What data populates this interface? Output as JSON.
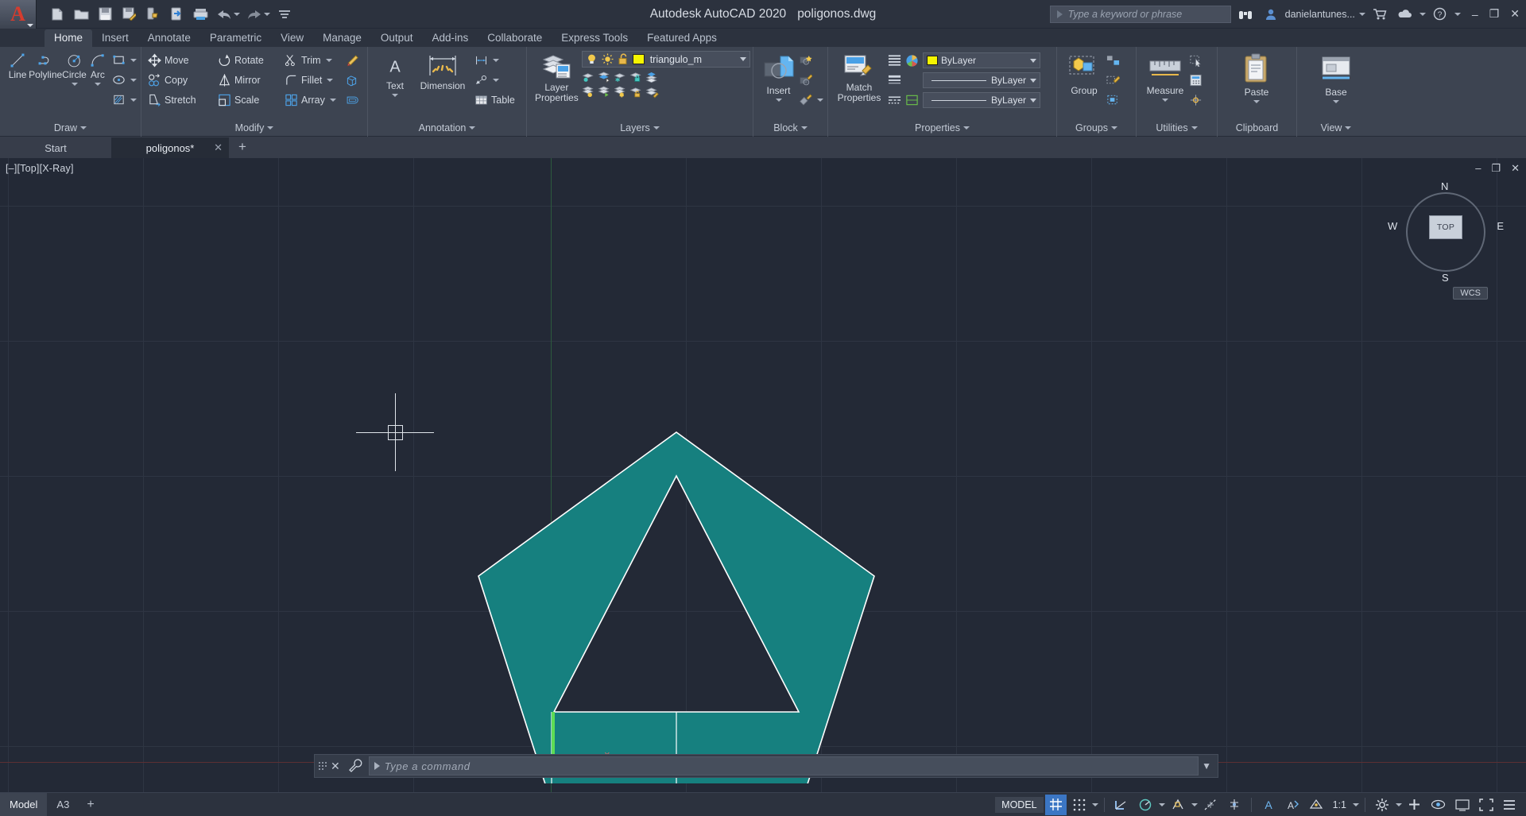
{
  "window": {
    "app_title": "Autodesk AutoCAD 2020",
    "file_name": "poligonos.dwg",
    "minimize": "–",
    "maximize": "❐",
    "close": "✕"
  },
  "quick_access": {
    "items": [
      {
        "name": "new-icon",
        "label": "New"
      },
      {
        "name": "open-icon",
        "label": "Open"
      },
      {
        "name": "save-icon",
        "label": "Save"
      },
      {
        "name": "save-as-icon",
        "label": "Save As"
      },
      {
        "name": "save-to-web-icon",
        "label": "Save to Web & Mobile"
      },
      {
        "name": "open-from-web-icon",
        "label": "Open from Web & Mobile"
      },
      {
        "name": "plot-icon",
        "label": "Plot"
      },
      {
        "name": "undo-icon",
        "label": "Undo"
      },
      {
        "name": "redo-icon",
        "label": "Redo"
      },
      {
        "name": "customize-icon",
        "label": "Customize Quick Access Toolbar"
      }
    ]
  },
  "search": {
    "placeholder": "Type a keyword or phrase"
  },
  "account": {
    "user": "danielantunes...",
    "signin_icon": "person-icon",
    "help_icon": "help-icon",
    "cart_icon": "cart-icon",
    "cloud_icon": "cloud-icon",
    "search_help_icon": "binoculars-icon"
  },
  "ribbon": {
    "tabs": [
      {
        "label": "Home",
        "active": true
      },
      {
        "label": "Insert",
        "active": false
      },
      {
        "label": "Annotate",
        "active": false
      },
      {
        "label": "Parametric",
        "active": false
      },
      {
        "label": "View",
        "active": false
      },
      {
        "label": "Manage",
        "active": false
      },
      {
        "label": "Output",
        "active": false
      },
      {
        "label": "Add-ins",
        "active": false
      },
      {
        "label": "Collaborate",
        "active": false
      },
      {
        "label": "Express Tools",
        "active": false
      },
      {
        "label": "Featured Apps",
        "active": false
      }
    ],
    "panels": {
      "draw": {
        "title": "Draw",
        "big_buttons": [
          {
            "label": "Line",
            "icon": "line-icon",
            "has_caret": false
          },
          {
            "label": "Polyline",
            "icon": "polyline-icon",
            "has_caret": false
          },
          {
            "label": "Circle",
            "icon": "circle-icon",
            "has_caret": true
          },
          {
            "label": "Arc",
            "icon": "arc-icon",
            "has_caret": true
          }
        ],
        "small_buttons": [
          {
            "icon": "rectangle-icon",
            "has_caret": true
          },
          {
            "icon": "ellipse-icon",
            "has_caret": true
          },
          {
            "icon": "hatch-icon",
            "has_caret": true
          }
        ]
      },
      "modify": {
        "title": "Modify",
        "rows": [
          [
            {
              "label": "Move",
              "icon": "move-icon"
            },
            {
              "label": "Rotate",
              "icon": "rotate-icon"
            },
            {
              "label": "Trim",
              "icon": "trim-icon",
              "has_caret": true
            },
            {
              "label": "",
              "icon": "erase-icon"
            }
          ],
          [
            {
              "label": "Copy",
              "icon": "copy-icon"
            },
            {
              "label": "Mirror",
              "icon": "mirror-icon"
            },
            {
              "label": "Fillet",
              "icon": "fillet-icon",
              "has_caret": true
            },
            {
              "label": "",
              "icon": "extrude-icon"
            }
          ],
          [
            {
              "label": "Stretch",
              "icon": "stretch-icon"
            },
            {
              "label": "Scale",
              "icon": "scale-icon"
            },
            {
              "label": "Array",
              "icon": "array-icon",
              "has_caret": true
            },
            {
              "label": "",
              "icon": "offset-icon"
            }
          ]
        ]
      },
      "annotation": {
        "title": "Annotation",
        "big_buttons": [
          {
            "label": "Text",
            "icon": "text-icon",
            "has_caret": true
          },
          {
            "label": "Dimension",
            "icon": "dimension-icon",
            "has_caret": false
          }
        ],
        "small_buttons": [
          {
            "icon": "linear-dim-icon",
            "has_caret": true
          },
          {
            "icon": "leader-icon",
            "has_caret": true
          },
          {
            "label": "Table",
            "icon": "table-icon",
            "has_caret": false
          }
        ]
      },
      "layers": {
        "title": "Layers",
        "big_button": {
          "label": "Layer Properties",
          "icon": "layer-properties-icon"
        },
        "layer_control": {
          "current_layer": "triangulo_m",
          "color_swatch": "#f5f500",
          "on_icon": "lightbulb-on-icon",
          "thaw_icon": "sun-icon",
          "unlock_icon": "unlock-icon"
        },
        "tool_icons": [
          "layer-off-icon",
          "layer-isolate-icon",
          "layer-freeze-icon",
          "layer-lock-icon",
          "layer-make-current-icon",
          "layer-on-icon",
          "layer-unisolate-icon",
          "layer-thaw-icon",
          "layer-unlock-icon",
          "layer-match-icon"
        ]
      },
      "block": {
        "title": "Block",
        "big_button": {
          "label": "Insert",
          "icon": "insert-block-icon",
          "has_caret": true
        },
        "small_buttons": [
          {
            "icon": "create-block-icon"
          },
          {
            "icon": "edit-block-icon"
          },
          {
            "icon": "edit-attribute-icon",
            "has_caret": true
          }
        ]
      },
      "properties": {
        "title": "Properties",
        "big_button": {
          "label": "Match Properties",
          "icon": "match-properties-icon"
        },
        "controls": [
          {
            "name": "color-control",
            "value": "ByLayer",
            "swatch": "#f5f500"
          },
          {
            "name": "lineweight-control",
            "value": "ByLayer"
          },
          {
            "name": "linetype-control",
            "value": "ByLayer"
          }
        ],
        "side_icons": [
          "property-list-icon",
          "color-wheel-icon",
          "linetype-list-icon",
          "transparency-icon"
        ]
      },
      "groups": {
        "title": "Groups",
        "big_button": {
          "label": "Group",
          "icon": "group-icon"
        },
        "small_buttons": [
          {
            "icon": "ungroup-icon"
          },
          {
            "icon": "group-edit-icon"
          },
          {
            "icon": "group-selection-icon"
          }
        ]
      },
      "utilities": {
        "title": "Utilities",
        "big_button": {
          "label": "Measure",
          "icon": "measure-icon",
          "has_caret": true
        },
        "small_buttons": [
          {
            "icon": "quick-select-icon"
          },
          {
            "icon": "quick-calc-icon"
          },
          {
            "icon": "id-point-icon"
          }
        ]
      },
      "clipboard": {
        "title": "Clipboard",
        "big_button": {
          "label": "Paste",
          "icon": "paste-icon",
          "has_caret": true
        }
      },
      "view": {
        "title": "View",
        "big_button": {
          "label": "Base",
          "icon": "base-view-icon",
          "has_caret": true
        }
      }
    }
  },
  "file_tabs": {
    "tabs": [
      {
        "label": "Start",
        "selected": false,
        "closable": false
      },
      {
        "label": "poligonos*",
        "selected": true,
        "closable": true
      }
    ],
    "add_label": "+",
    "close_glyph": "✕"
  },
  "viewport": {
    "label": "[–][Top][X-Ray]",
    "minimize": "–",
    "restore": "❐",
    "close": "✕",
    "viewcube": {
      "top": "TOP",
      "n": "N",
      "s": "S",
      "e": "E",
      "w": "W"
    },
    "ucs_badge": "WCS",
    "shape_fill": "#16807f",
    "shape_stroke": "#ffffff",
    "background": "#232936"
  },
  "command_line": {
    "placeholder": "Type a command",
    "close_glyph": "✕",
    "tool_icon": "wrench-icon",
    "expand_glyph": "▼"
  },
  "status_bar": {
    "model_tabs": [
      {
        "label": "Model",
        "selected": true
      },
      {
        "label": "A3",
        "selected": false
      }
    ],
    "add_layout": "+",
    "space_label": "MODEL",
    "scale": "1:1",
    "items": [
      {
        "name": "grid-display-toggle",
        "icon": "grid-icon",
        "on": true
      },
      {
        "name": "snap-mode-toggle",
        "icon": "snap-icon",
        "on": false,
        "has_caret": true
      },
      {
        "name": "ortho-mode-toggle",
        "icon": "ortho-icon",
        "on": false
      },
      {
        "name": "polar-tracking-toggle",
        "icon": "polar-icon",
        "on": false,
        "has_caret": true
      },
      {
        "name": "osnap-toggle",
        "icon": "osnap-icon",
        "on": false,
        "has_caret": true
      },
      {
        "name": "otrack-toggle",
        "icon": "otrack-icon",
        "on": false
      },
      {
        "name": "lineweight-toggle",
        "icon": "lineweight-icon",
        "on": false
      },
      {
        "name": "transparency-toggle",
        "icon": "transparency-icon",
        "on": false
      },
      {
        "name": "selection-cycling-toggle",
        "icon": "selection-cycling-icon",
        "on": false,
        "has_caret": true
      },
      {
        "name": "annotation-visibility-toggle",
        "icon": "annotation-visibility-icon",
        "on": false
      },
      {
        "name": "autoscale-toggle",
        "icon": "autoscale-icon",
        "on": false
      },
      {
        "name": "annotation-scale-control",
        "icon": "annotation-scale-icon",
        "on": false
      },
      {
        "name": "workspace-switching",
        "icon": "gear-icon",
        "on": false,
        "has_caret": true
      },
      {
        "name": "customization",
        "icon": "plus-icon",
        "on": false
      },
      {
        "name": "isolate-objects",
        "icon": "isolate-icon",
        "on": false
      },
      {
        "name": "hardware-acceleration",
        "icon": "screen-icon",
        "on": false
      },
      {
        "name": "clean-screen",
        "icon": "fullscreen-icon",
        "on": false
      },
      {
        "name": "status-menu",
        "icon": "hamburger-icon",
        "on": false
      }
    ]
  }
}
